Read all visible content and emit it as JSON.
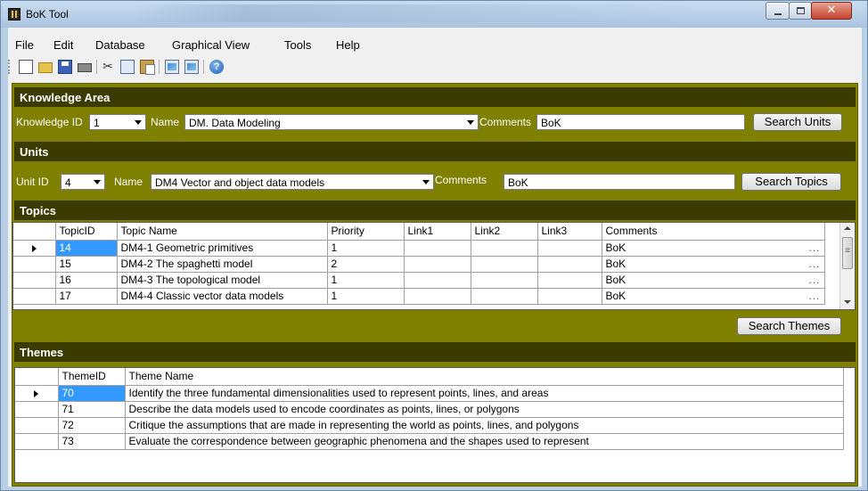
{
  "window": {
    "title": "BoK Tool"
  },
  "menu": [
    "File",
    "Edit",
    "Database",
    "Graphical View",
    "Tools",
    "Help"
  ],
  "toolbar": {
    "icons": [
      "new-file-icon",
      "open-folder-icon",
      "save-icon",
      "print-icon",
      "cut-icon",
      "copy-icon",
      "paste-icon",
      "image-export-icon",
      "image-import-icon",
      "help-icon"
    ]
  },
  "knowledge_area": {
    "header": "Knowledge Area",
    "id_label": "Knowledge ID",
    "id_value": "1",
    "name_label": "Name",
    "name_value": "DM. Data Modeling",
    "comments_label": "Comments",
    "comments_value": "BoK",
    "search_button": "Search Units"
  },
  "units": {
    "header": "Units",
    "id_label": "Unit ID",
    "id_value": "4",
    "name_label": "Name",
    "name_value": "DM4 Vector and object data models",
    "comments_label": "Comments",
    "comments_value": "BoK",
    "search_button": "Search Topics"
  },
  "topics": {
    "header": "Topics",
    "columns": [
      "TopicID",
      "Topic Name",
      "Priority",
      "Link1",
      "Link2",
      "Link3",
      "Comments"
    ],
    "rows": [
      {
        "id": "14",
        "name": "DM4-1 Geometric primitives",
        "priority": "1",
        "link1": "",
        "link2": "",
        "link3": "",
        "comments": "BoK",
        "more": "..."
      },
      {
        "id": "15",
        "name": "DM4-2 The spaghetti model",
        "priority": "2",
        "link1": "",
        "link2": "",
        "link3": "",
        "comments": "BoK",
        "more": "..."
      },
      {
        "id": "16",
        "name": "DM4-3 The topological model",
        "priority": "1",
        "link1": "",
        "link2": "",
        "link3": "",
        "comments": "BoK",
        "more": "..."
      },
      {
        "id": "17",
        "name": "DM4-4 Classic vector data models",
        "priority": "1",
        "link1": "",
        "link2": "",
        "link3": "",
        "comments": "BoK",
        "more": "..."
      }
    ],
    "search_button": "Search Themes"
  },
  "themes": {
    "header": "Themes",
    "columns": [
      "ThemeID",
      "Theme Name"
    ],
    "rows": [
      {
        "id": "70",
        "name": "Identify the three fundamental dimensionalities used to represent points, lines, and areas"
      },
      {
        "id": "71",
        "name": "Describe the data models used to encode coordinates as points, lines, or polygons"
      },
      {
        "id": "72",
        "name": "Critique the assumptions that are made in representing the world as points, lines, and polygons"
      },
      {
        "id": "73",
        "name": "Evaluate the correspondence between geographic phenomena and the shapes used to represent"
      }
    ]
  },
  "colors": {
    "panel": "#808000",
    "section_header": "#3b3b00",
    "selection": "#3399ff"
  }
}
